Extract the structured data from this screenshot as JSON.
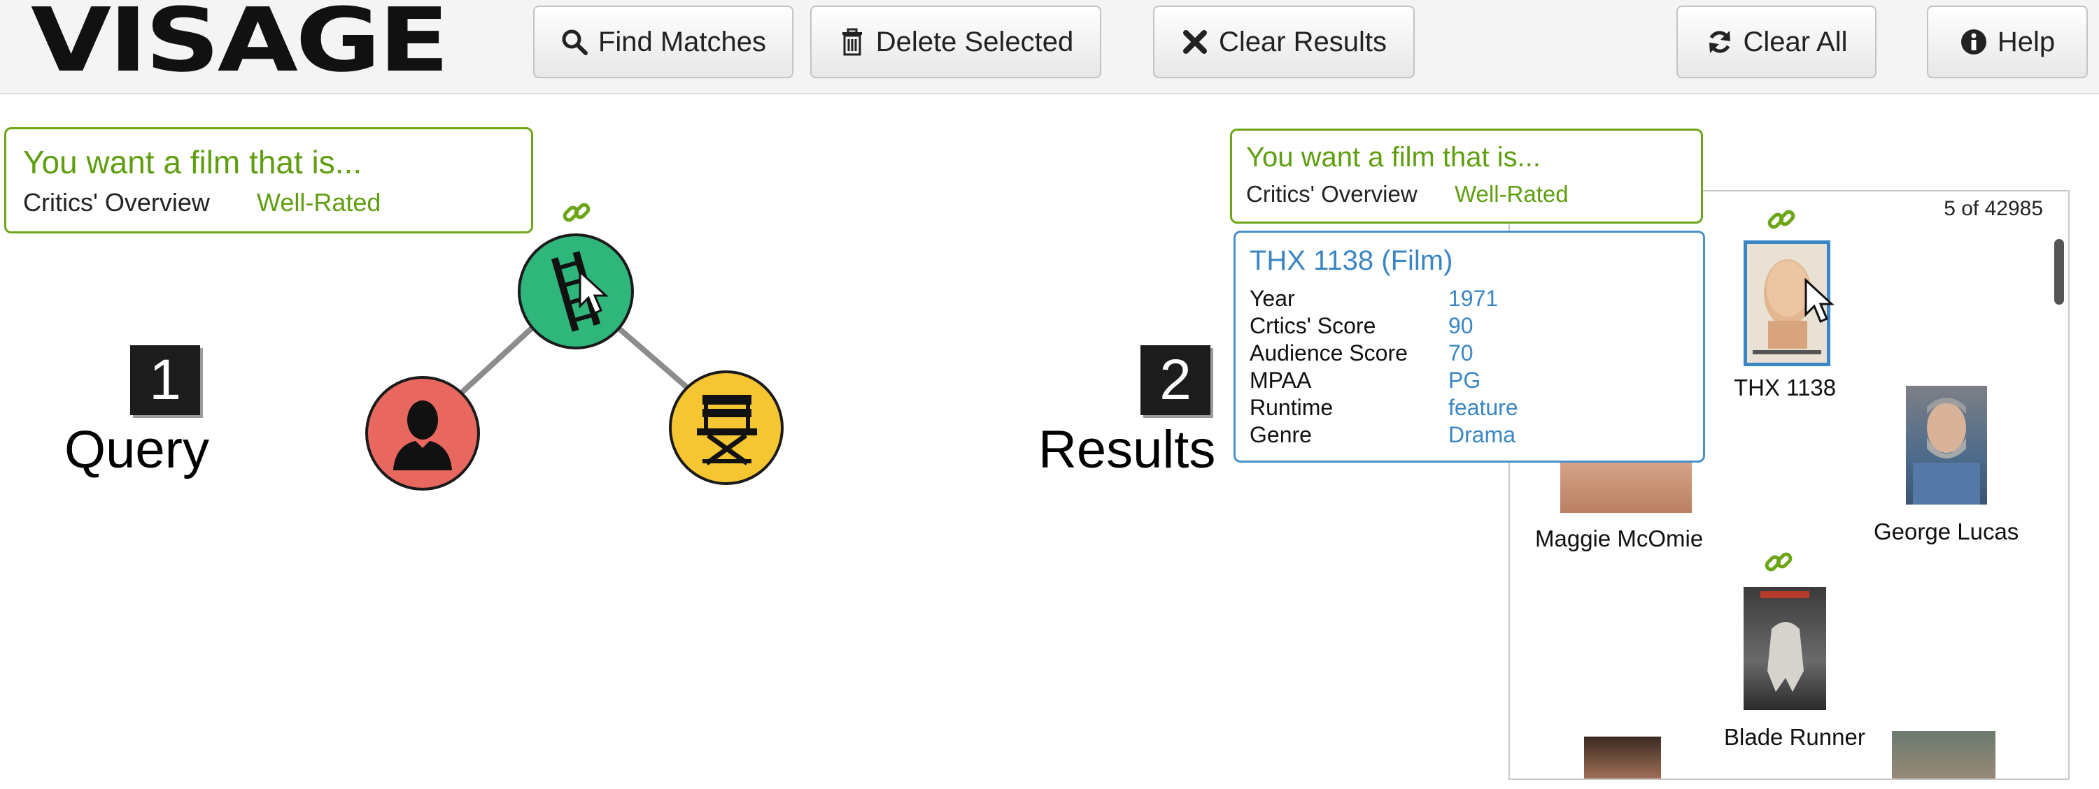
{
  "app": {
    "logo": "VISAGE"
  },
  "toolbar": {
    "find_matches": "Find Matches",
    "delete_selected": "Delete Selected",
    "clear_results": "Clear Results",
    "clear_all": "Clear All",
    "help": "Help"
  },
  "query": {
    "step_number": "1",
    "step_label": "Query",
    "pref_title": "You want a film that is...",
    "pref_key": "Critics' Overview",
    "pref_value": "Well-Rated",
    "nodes": [
      "film-icon",
      "person-icon",
      "director-chair-icon"
    ]
  },
  "results": {
    "step_number": "2",
    "step_label": "Results",
    "pref_title": "You want a film that is...",
    "pref_key": "Critics' Overview",
    "pref_value": "Well-Rated",
    "count": "5 of 42985",
    "nodes": {
      "thx": "THX 1138",
      "maggie": "Maggie McOmie",
      "lucas": "George Lucas",
      "blade": "Blade Runner"
    },
    "detail": {
      "title": "THX 1138 (Film)",
      "rows": [
        {
          "key": "Year",
          "value": "1971"
        },
        {
          "key": "Crtics' Score",
          "value": "90"
        },
        {
          "key": "Audience Score",
          "value": "70"
        },
        {
          "key": "MPAA",
          "value": "PG"
        },
        {
          "key": "Runtime",
          "value": "feature"
        },
        {
          "key": "Genre",
          "value": "Drama"
        }
      ]
    }
  },
  "colors": {
    "accent_green": "#5f9e10",
    "link_blue": "#3a86c4",
    "film_node": "#2fb67a",
    "person_node": "#e8675e",
    "director_node": "#f6c632"
  }
}
